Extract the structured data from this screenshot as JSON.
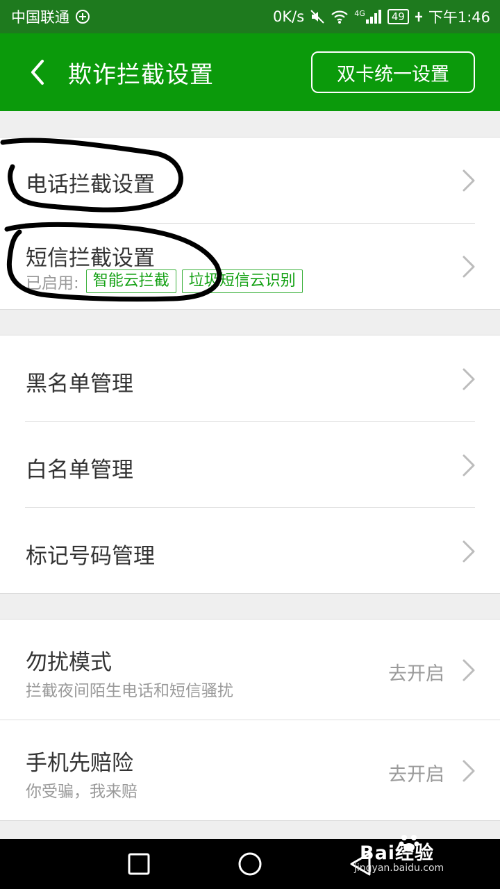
{
  "status_bar": {
    "carrier": "中国联通",
    "net_speed": "0K/s",
    "network": "4G",
    "battery": "49",
    "time": "下午1:46",
    "icons": [
      "data-saver-icon",
      "mute-icon",
      "wifi-icon",
      "signal-icon",
      "charging-icon"
    ]
  },
  "header": {
    "title": "欺诈拦截设置",
    "dual_sim_button": "双卡统一设置",
    "icon": "back-arrow-icon"
  },
  "interception": {
    "call": {
      "label": "电话拦截设置"
    },
    "sms": {
      "label": "短信拦截设置",
      "enabled_label": "已启用:",
      "tags": [
        "智能云拦截",
        "垃圾短信云识别"
      ]
    }
  },
  "lists": {
    "blacklist": "黑名单管理",
    "whitelist": "白名单管理",
    "marked_numbers": "标记号码管理"
  },
  "features": {
    "dnd": {
      "title": "勿扰模式",
      "subtitle": "拦截夜间陌生电话和短信骚扰",
      "action": "去开启"
    },
    "insurance": {
      "title": "手机先赔险",
      "subtitle": "你受骗，我来赔",
      "action": "去开启"
    }
  },
  "nav_bar": {
    "icons": [
      "recent-apps-icon",
      "home-icon",
      "back-icon"
    ]
  },
  "watermark": {
    "brand": "Bai经验",
    "url": "jingyan.baidu.com"
  },
  "colors": {
    "app_bar": "#0b9a0b",
    "status_bar": "#1e7a1e",
    "tag": "#12a012",
    "background": "#efefef"
  }
}
